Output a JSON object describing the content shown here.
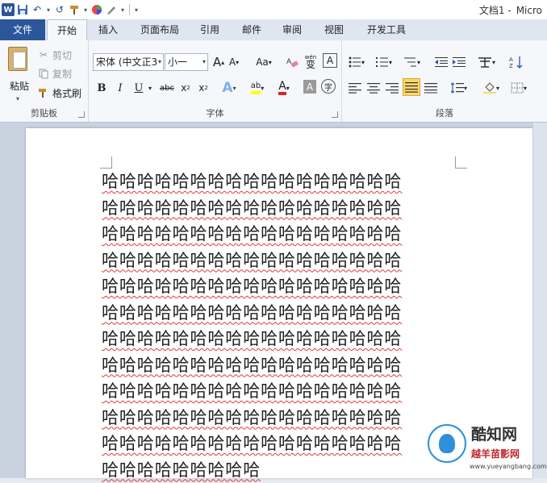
{
  "titlebar": {
    "app_icon": "W",
    "undo_icon": "↶",
    "redo_icon": "↺",
    "title_doc": "文档1 -",
    "title_app": "Micro"
  },
  "tabs": {
    "file": "文件",
    "home": "开始",
    "insert": "插入",
    "layout": "页面布局",
    "references": "引用",
    "mailings": "邮件",
    "review": "审阅",
    "view": "视图",
    "developer": "开发工具"
  },
  "clipboard": {
    "paste": "粘贴",
    "cut": "剪切",
    "copy": "复制",
    "format_painter": "格式刷",
    "group_label": "剪贴板"
  },
  "font": {
    "font_name": "宋体 (中文正3",
    "font_size": "小一",
    "grow": "A",
    "shrink": "A",
    "change_case": "Aa",
    "pinyin": "wén",
    "pinyin_char": "变",
    "border_char": "A",
    "bold": "B",
    "italic": "I",
    "underline": "U",
    "strike": "abc",
    "subscript": "x",
    "superscript": "x",
    "effects": "A",
    "highlight": "ab",
    "color": "A",
    "shading": "A",
    "enclose": "字",
    "group_label": "字体"
  },
  "paragraph": {
    "group_label": "段落"
  },
  "document": {
    "lines": [
      "哈哈哈哈哈哈哈哈哈哈哈哈哈哈哈哈哈",
      "哈哈哈哈哈哈哈哈哈哈哈哈哈哈哈哈哈",
      "哈哈哈哈哈哈哈哈哈哈哈哈哈哈哈哈哈",
      "哈哈哈哈哈哈哈哈哈哈哈哈哈哈哈哈哈",
      "哈哈哈哈哈哈哈哈哈哈哈哈哈哈哈哈哈",
      "哈哈哈哈哈哈哈哈哈哈哈哈哈哈哈哈哈",
      "哈哈哈哈哈哈哈哈哈哈哈哈哈哈哈哈哈",
      "哈哈哈哈哈哈哈哈哈哈哈哈哈哈哈哈哈",
      "哈哈哈哈哈哈哈哈哈哈哈哈哈哈哈哈哈",
      "哈哈哈哈哈哈哈哈哈哈哈哈哈哈哈哈哈",
      "哈哈哈哈哈哈哈哈哈哈哈哈哈哈哈哈哈",
      "哈哈哈哈哈哈哈哈哈"
    ]
  },
  "watermark": {
    "brand": "酷知网",
    "site": "越羊苗影网",
    "url": "www.yueyangbang.com"
  }
}
